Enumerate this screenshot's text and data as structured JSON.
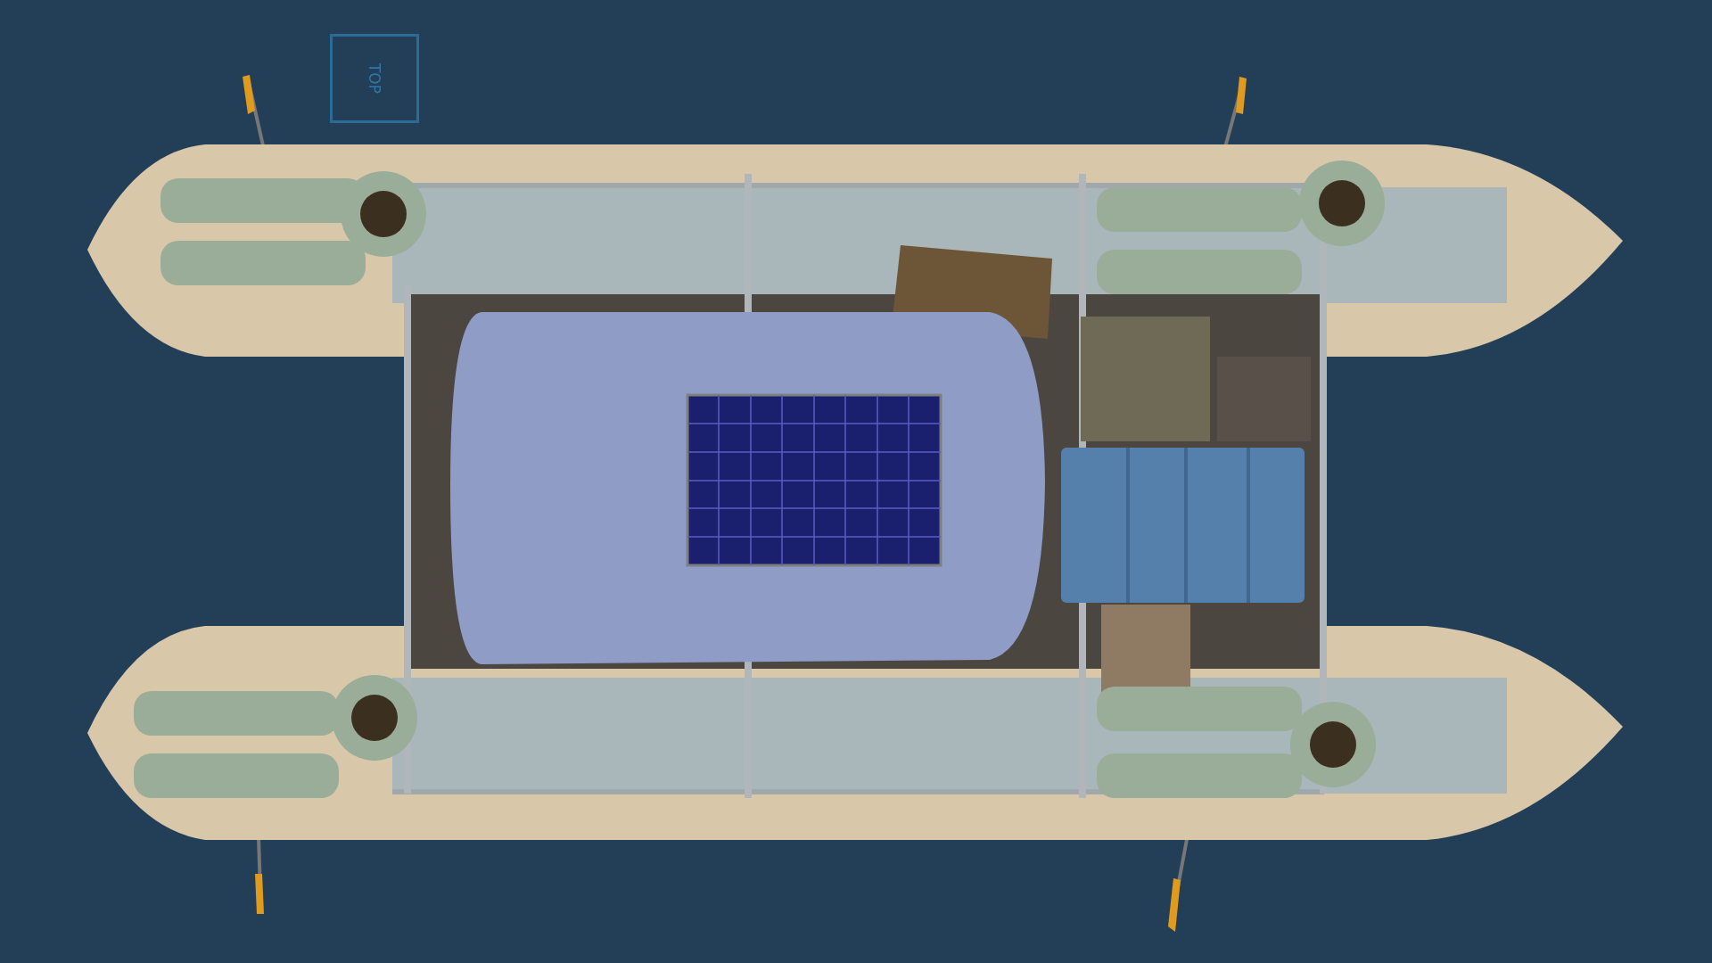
{
  "viewport": {
    "view_cube": {
      "label": "TOP"
    }
  }
}
